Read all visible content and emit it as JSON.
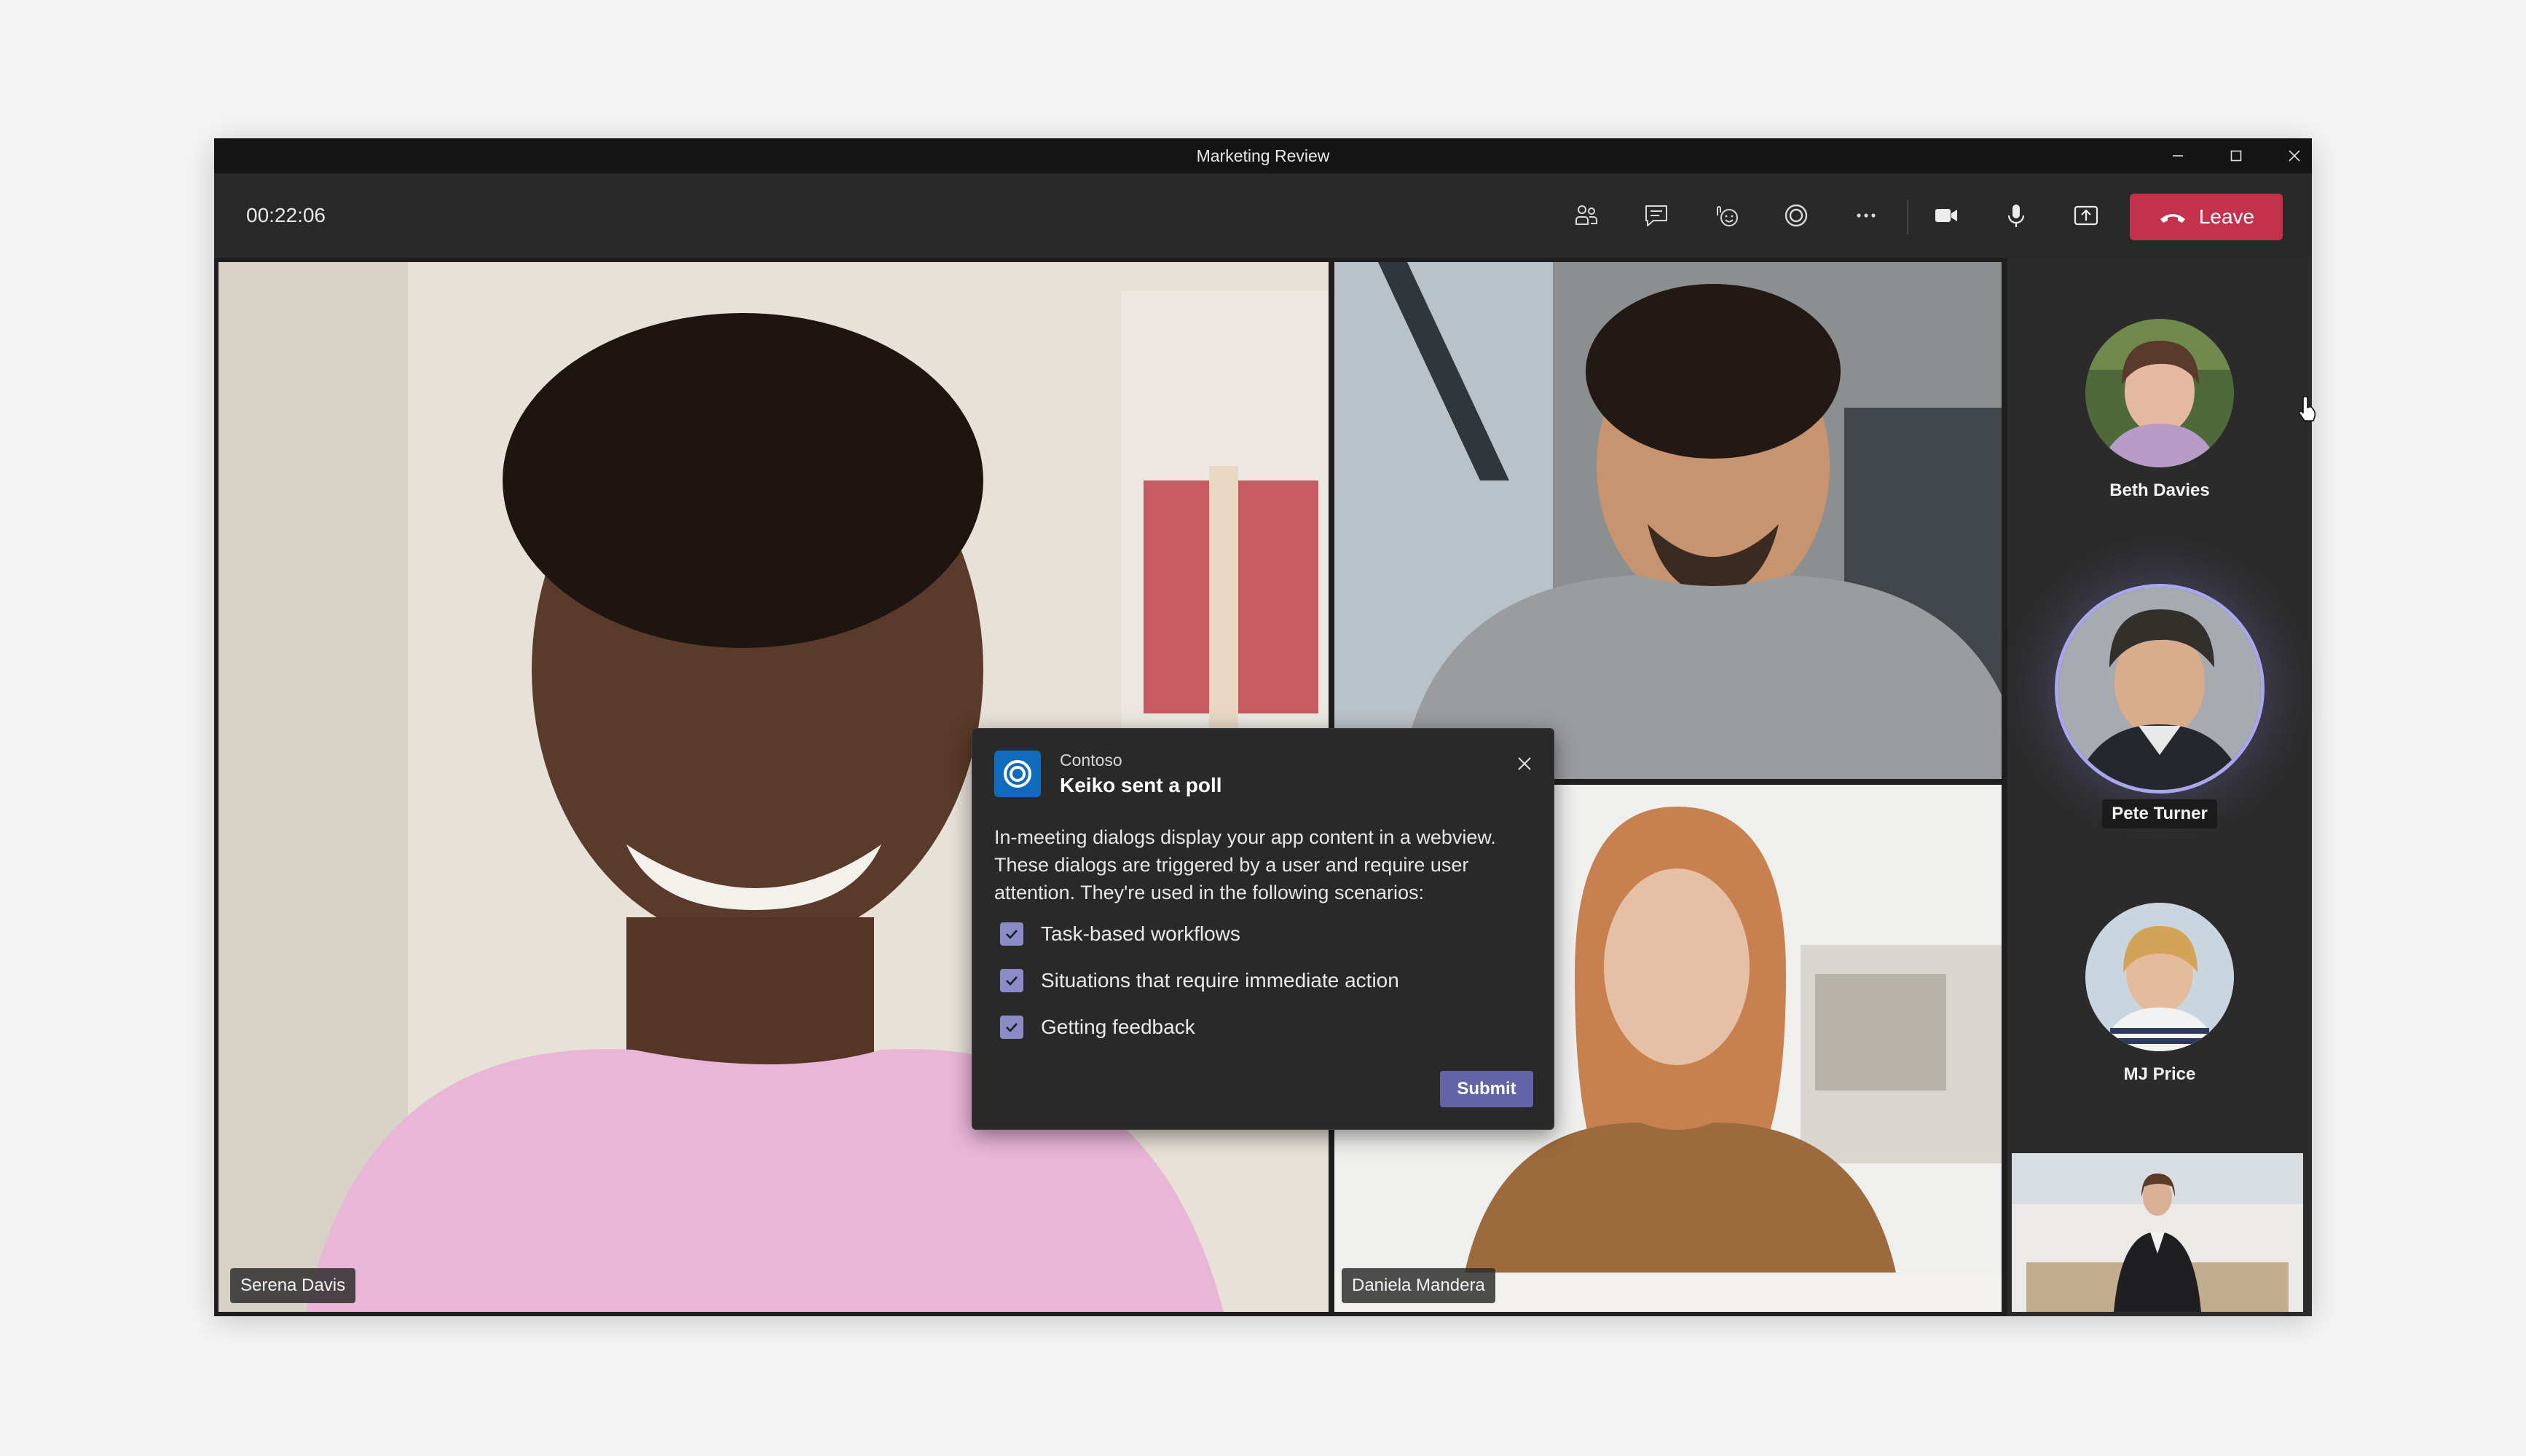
{
  "window": {
    "title": "Marketing Review"
  },
  "toolbar": {
    "timer": "00:22:06",
    "icons": [
      "people-icon",
      "chat-icon",
      "reactions-icon",
      "apps-icon",
      "more-icon",
      "camera-icon",
      "mic-icon",
      "share-icon"
    ],
    "leave_label": "Leave",
    "leave_color": "#c4314b"
  },
  "stage": {
    "tiles": [
      {
        "name": "Serena Davis"
      },
      {
        "name": "Daniela Mandera"
      }
    ]
  },
  "sidebar": {
    "participants": [
      {
        "name": "Beth Davies"
      },
      {
        "name": "Pete Turner",
        "speaking": true
      },
      {
        "name": "MJ Price"
      }
    ]
  },
  "dialog": {
    "app_name": "Contoso",
    "title": "Keiko sent a poll",
    "body": "In-meeting dialogs display your app content in a webview. These dialogs are triggered by a user and require user attention. They're used in the following scenarios:",
    "options": [
      {
        "label": "Task-based workflows",
        "checked": true
      },
      {
        "label": "Situations that require immediate action",
        "checked": true
      },
      {
        "label": "Getting feedback",
        "checked": true
      }
    ],
    "submit_label": "Submit",
    "accent": "#6264a7",
    "app_color": "#0f6cbd"
  }
}
